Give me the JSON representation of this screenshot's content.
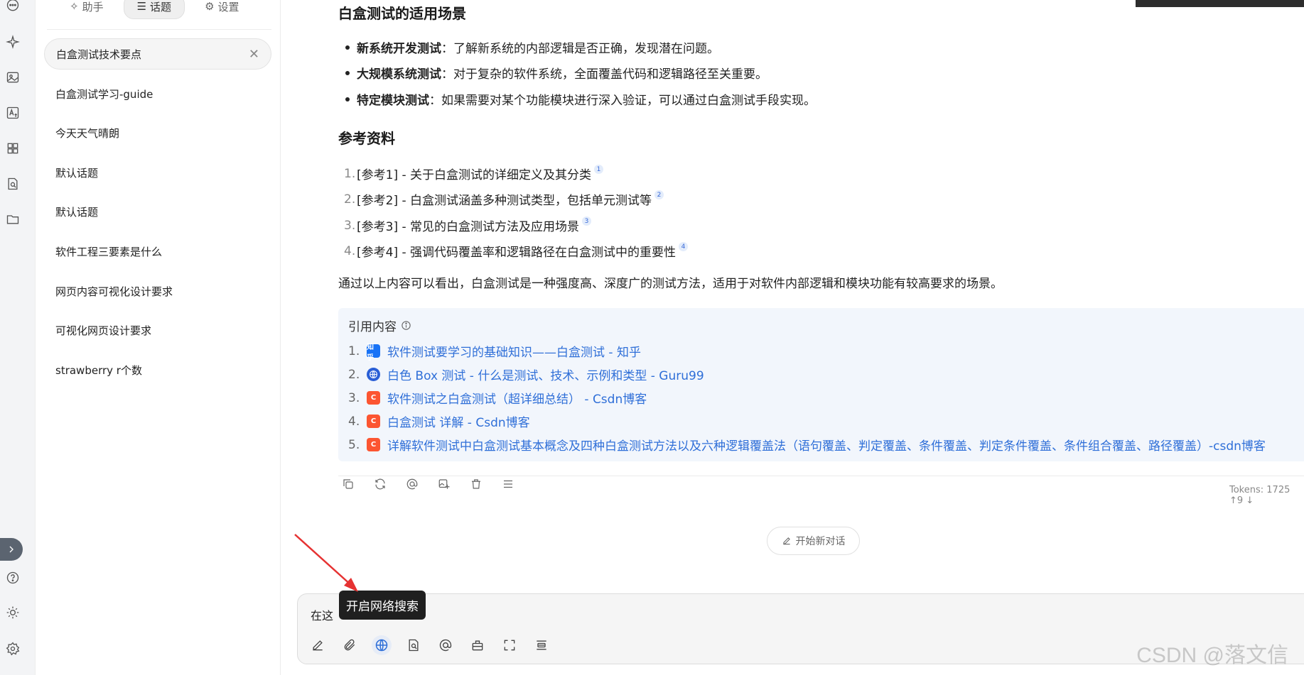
{
  "sidebar_tabs": [
    {
      "label": "助手",
      "icon": "sparkle-icon"
    },
    {
      "label": "话题",
      "icon": "list-icon"
    },
    {
      "label": "设置",
      "icon": "gear-icon"
    }
  ],
  "topics": {
    "active": "白盒测试技术要点",
    "items": [
      "白盒测试学习-guide",
      "今天天气晴朗",
      "默认话题",
      "默认话题",
      "软件工程三要素是什么",
      "网页内容可视化设计要求",
      "可视化网页设计要求",
      "strawberry r个数"
    ]
  },
  "content": {
    "scenario_heading": "白盒测试的适用场景",
    "scenarios": [
      {
        "bold": "新系统开发测试",
        "text": "：了解新系统的内部逻辑是否正确，发现潜在问题。"
      },
      {
        "bold": "大规模系统测试",
        "text": "：对于复杂的软件系统，全面覆盖代码和逻辑路径至关重要。"
      },
      {
        "bold": "特定模块测试",
        "text": "：如果需要对某个功能模块进行深入验证，可以通过白盒测试手段实现。"
      }
    ],
    "refs_heading": "参考资料",
    "refs": [
      {
        "num": "1.",
        "text": "[参考1] - 关于白盒测试的详细定义及其分类",
        "sup": "1"
      },
      {
        "num": "2.",
        "text": "[参考2] - 白盒测试涵盖多种测试类型，包括单元测试等",
        "sup": "2"
      },
      {
        "num": "3.",
        "text": "[参考3] - 常见的白盒测试方法及应用场景",
        "sup": "3"
      },
      {
        "num": "4.",
        "text": "[参考4] - 强调代码覆盖率和逻辑路径在白盒测试中的重要性",
        "sup": "4"
      }
    ],
    "summary": "通过以上内容可以看出，白盒测试是一种强度高、深度广的测试方法，适用于对软件内部逻辑和模块功能有较高要求的场景。"
  },
  "citations": {
    "title": "引用内容",
    "items": [
      {
        "num": "1.",
        "text": "软件测试要学习的基础知识——白盒测试 - 知乎",
        "icon": "zhihu-icon",
        "icon_text": "知乎",
        "color": "#1772f6"
      },
      {
        "num": "2.",
        "text": "白色 Box 测试 - 什么是测试、技术、示例和类型 - Guru99",
        "icon": "globe-icon",
        "icon_text": "",
        "color": "#2a5fd6"
      },
      {
        "num": "3.",
        "text": "软件测试之白盒测试（超详细总结） - Csdn博客",
        "icon": "csdn-icon",
        "icon_text": "C",
        "color": "#fc5531"
      },
      {
        "num": "4.",
        "text": "白盒测试 详解 - Csdn博客",
        "icon": "csdn-icon",
        "icon_text": "C",
        "color": "#fc5531"
      },
      {
        "num": "5.",
        "text": "详解软件测试中白盒测试基本概念及四种白盒测试方法以及六种逻辑覆盖法（语句覆盖、判定覆盖、条件覆盖、判定条件覆盖、条件组合覆盖、路径覆盖）-csdn博客",
        "icon": "csdn-icon",
        "icon_text": "C",
        "color": "#fc5531"
      }
    ]
  },
  "tokens": "Tokens: 1725 ↑9 ↓",
  "new_chat_label": "开始新对话",
  "input": {
    "value": "在这"
  },
  "tooltip": "开启网络搜索",
  "watermark": "CSDN @落文信"
}
